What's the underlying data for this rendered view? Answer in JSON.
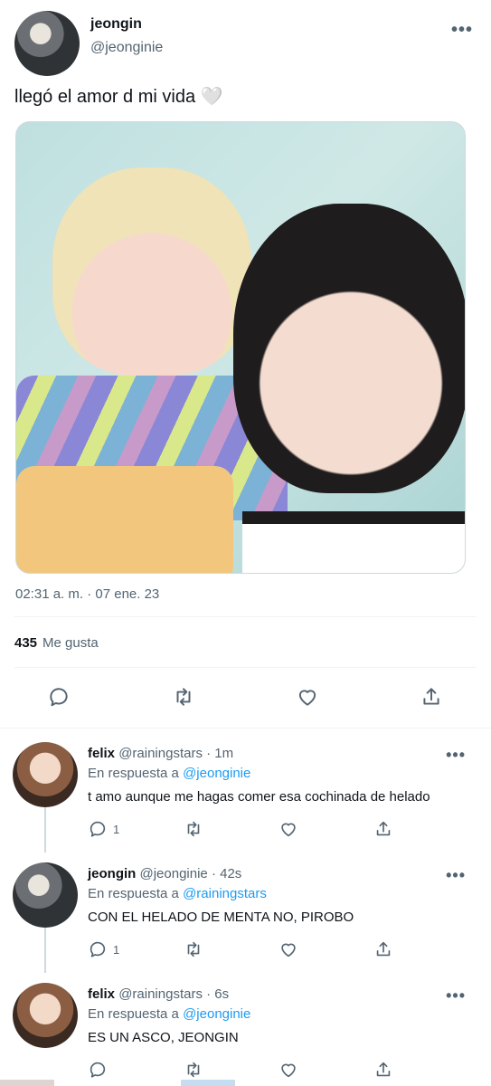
{
  "main_tweet": {
    "author_name": "jeongin",
    "author_handle": "@jeonginie",
    "text": "llegó el amor d mi vida 🤍",
    "timestamp": "02:31 a. m. · 07 ene. 23",
    "likes_count": "435",
    "likes_label": "Me gusta",
    "more_label": "•••"
  },
  "replies": [
    {
      "author_name": "felix",
      "author_handle": "@rainingstars · 1m",
      "reply_prefix": "En respuesta a ",
      "reply_to": "@jeonginie",
      "text": "t amo aunque me hagas comer esa cochinada de helado",
      "reply_count": "1",
      "more_label": "•••"
    },
    {
      "author_name": "jeongin",
      "author_handle": "@jeonginie · 42s",
      "reply_prefix": "En respuesta a ",
      "reply_to": "@rainingstars",
      "text": "CON EL HELADO DE MENTA NO, PIROBO",
      "reply_count": "1",
      "more_label": "•••"
    },
    {
      "author_name": "felix",
      "author_handle": "@rainingstars · 6s",
      "reply_prefix": "En respuesta a ",
      "reply_to": "@jeonginie",
      "text": "ES UN ASCO, JEONGIN",
      "reply_count": "",
      "more_label": "•••"
    }
  ],
  "icons": {
    "reply": "reply-icon",
    "retweet": "retweet-icon",
    "like": "heart-icon",
    "share": "share-icon"
  }
}
